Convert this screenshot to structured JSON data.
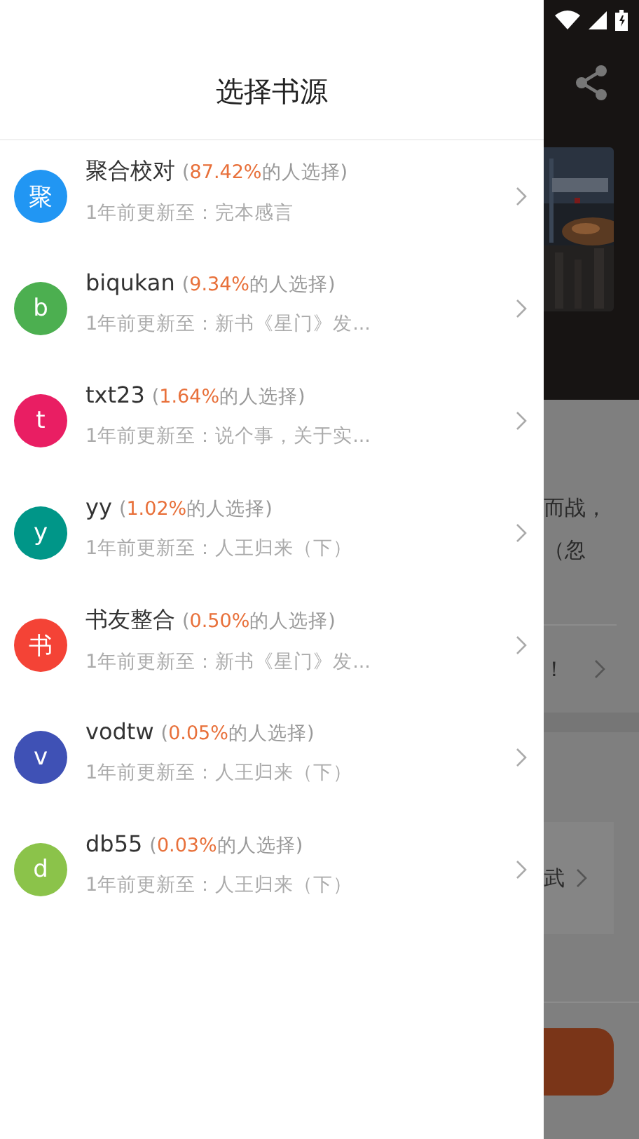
{
  "drawer": {
    "title": "选择书源",
    "sources": [
      {
        "avatar": "聚",
        "color": "#2196f3",
        "name": "聚合校对",
        "open": "(",
        "percent": "87.42%",
        "close": "的人选择)",
        "update": "1年前更新至：完本感言"
      },
      {
        "avatar": "b",
        "color": "#4caf50",
        "name": "biqukan",
        "open": "(",
        "percent": "9.34%",
        "close": "的人选择)",
        "update": "1年前更新至：新书《星门》发..."
      },
      {
        "avatar": "t",
        "color": "#e91e63",
        "name": "txt23",
        "open": "(",
        "percent": "1.64%",
        "close": "的人选择)",
        "update": "1年前更新至：说个事，关于实..."
      },
      {
        "avatar": "y",
        "color": "#009688",
        "name": "yy",
        "open": "(",
        "percent": "1.02%",
        "close": "的人选择)",
        "update": "1年前更新至：人王归来（下）"
      },
      {
        "avatar": "书",
        "color": "#f44336",
        "name": "书友整合",
        "open": "(",
        "percent": "0.50%",
        "close": "的人选择)",
        "update": "1年前更新至：新书《星门》发..."
      },
      {
        "avatar": "v",
        "color": "#3f51b5",
        "name": "vodtw",
        "open": "(",
        "percent": "0.05%",
        "close": "的人选择)",
        "update": "1年前更新至：人王归来（下）"
      },
      {
        "avatar": "d",
        "color": "#8bc34a",
        "name": "db55",
        "open": "(",
        "percent": "0.03%",
        "close": "的人选择)",
        "update": "1年前更新至：人王归来（下）"
      }
    ]
  },
  "background_page": {
    "description_lines": [
      "而战，",
      "（忽"
    ],
    "row_label": "！",
    "card_label": "武"
  }
}
